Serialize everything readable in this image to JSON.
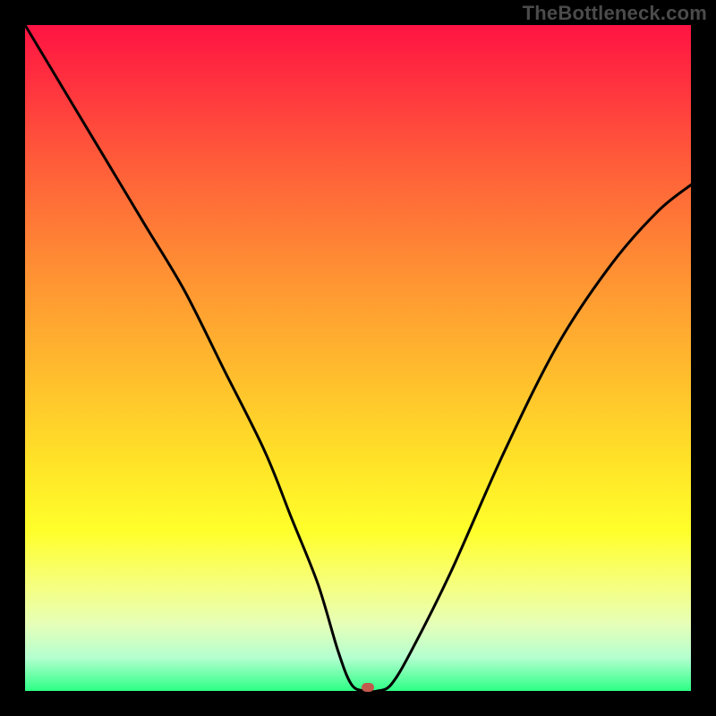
{
  "watermark": "TheBottleneck.com",
  "chart_data": {
    "type": "line",
    "title": "",
    "xlabel": "",
    "ylabel": "",
    "xlim": [
      0,
      100
    ],
    "ylim": [
      0,
      100
    ],
    "series": [
      {
        "name": "bottleneck-curve",
        "x": [
          0,
          6,
          12,
          18,
          24,
          30,
          36,
          40,
          44,
          47,
          49,
          51,
          53,
          55,
          58,
          64,
          72,
          80,
          88,
          95,
          100
        ],
        "values": [
          100,
          90,
          80,
          70,
          60,
          48,
          36,
          26,
          16,
          6,
          1,
          0,
          0,
          1,
          6,
          18,
          36,
          52,
          64,
          72,
          76
        ]
      }
    ],
    "marker": {
      "x": 51.5,
      "y": 0.5,
      "color": "#c15a4c"
    },
    "gradient_stops": [
      {
        "pct": 0,
        "color": "#ff1443"
      },
      {
        "pct": 20,
        "color": "#ff5a3a"
      },
      {
        "pct": 50,
        "color": "#ffb62e"
      },
      {
        "pct": 76,
        "color": "#ffff2a"
      },
      {
        "pct": 100,
        "color": "#2cff85"
      }
    ]
  }
}
